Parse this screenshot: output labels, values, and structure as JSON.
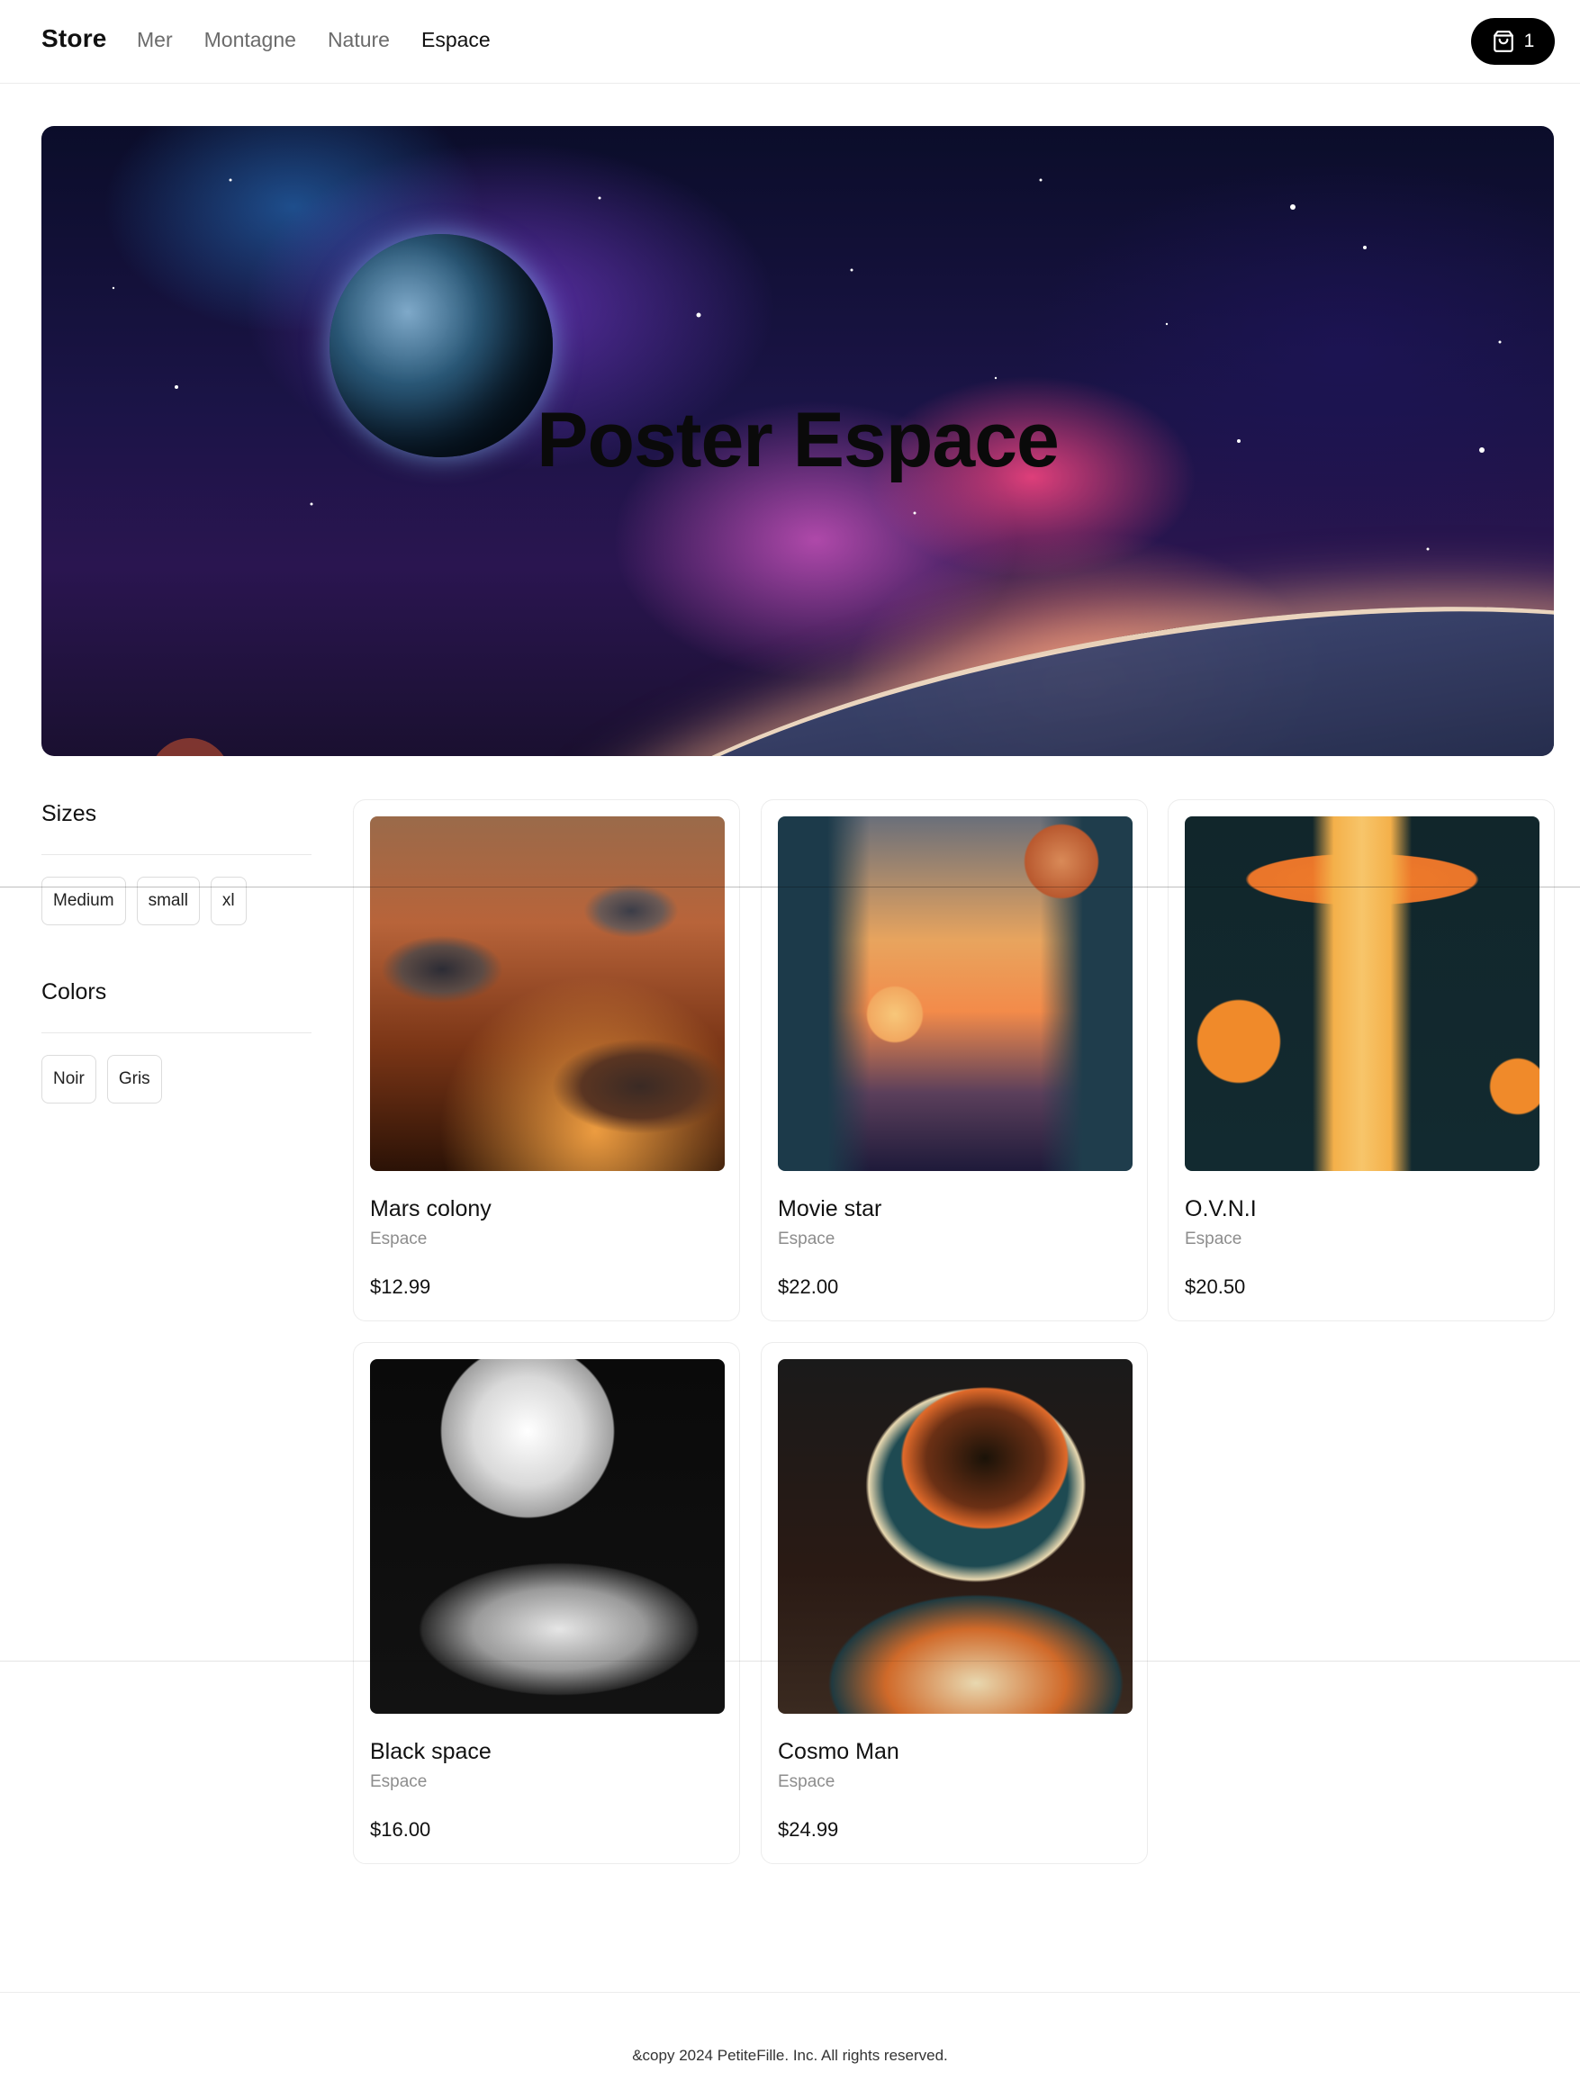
{
  "header": {
    "logo": "Store",
    "nav": [
      "Mer",
      "Montagne",
      "Nature",
      "Espace"
    ],
    "active_nav": "Espace",
    "cart_count": "1",
    "cart_icon": "shopping-bag-icon"
  },
  "hero": {
    "title": "Poster Espace"
  },
  "filters": {
    "sizes_title": "Sizes",
    "sizes": [
      "Medium",
      "small",
      "xl"
    ],
    "colors_title": "Colors",
    "colors": [
      "Noir",
      "Gris"
    ]
  },
  "products": [
    {
      "name": "Mars colony",
      "category": "Espace",
      "price": "$12.99"
    },
    {
      "name": "Movie star",
      "category": "Espace",
      "price": "$22.00"
    },
    {
      "name": "O.V.N.I",
      "category": "Espace",
      "price": "$20.50"
    },
    {
      "name": "Black space",
      "category": "Espace",
      "price": "$16.00"
    },
    {
      "name": "Cosmo Man",
      "category": "Espace",
      "price": "$24.99"
    }
  ],
  "footer": {
    "text": "&copy 2024 PetiteFille. Inc. All rights reserved."
  }
}
